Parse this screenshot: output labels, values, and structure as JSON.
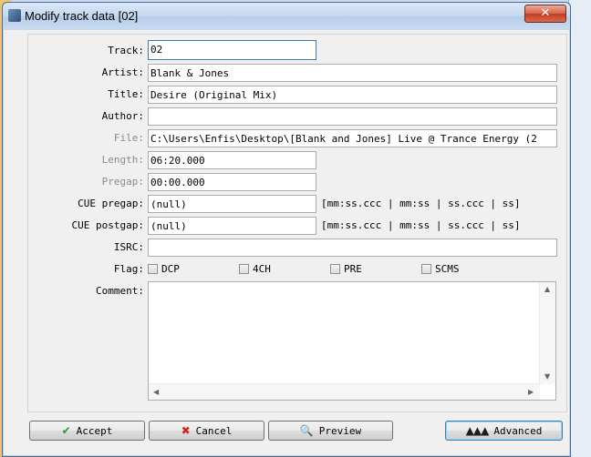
{
  "window": {
    "title": "Modify track data [02]",
    "close_glyph": "✕"
  },
  "fields": {
    "track": {
      "label": "Track:",
      "value": "02"
    },
    "artist": {
      "label": "Artist:",
      "value": "Blank & Jones"
    },
    "title": {
      "label": "Title:",
      "value": "Desire (Original Mix)"
    },
    "author": {
      "label": "Author:",
      "value": ""
    },
    "file": {
      "label": "File:",
      "value": "C:\\Users\\Enfis\\Desktop\\[Blank and Jones] Live @ Trance Energy (2"
    },
    "length": {
      "label": "Length:",
      "value": "06:20.000"
    },
    "pregap": {
      "label": "Pregap:",
      "value": "00:00.000"
    },
    "cue_pregap": {
      "label": "CUE pregap:",
      "value": "(null)",
      "hint": "[mm:ss.ccc | mm:ss | ss.ccc | ss]"
    },
    "cue_postgap": {
      "label": "CUE postgap:",
      "value": "(null)",
      "hint": "[mm:ss.ccc | mm:ss | ss.ccc | ss]"
    },
    "isrc": {
      "label": "ISRC:",
      "value": ""
    },
    "flag": {
      "label": "Flag:",
      "options": [
        "DCP",
        "4CH",
        "PRE",
        "SCMS"
      ]
    },
    "comment": {
      "label": "Comment:",
      "value": ""
    }
  },
  "buttons": {
    "accept": "Accept",
    "cancel": "Cancel",
    "preview": "Preview",
    "advanced": "Advanced"
  },
  "colors": {
    "accent": "#3d7bad",
    "disabled_label": "#8a8a8a"
  }
}
